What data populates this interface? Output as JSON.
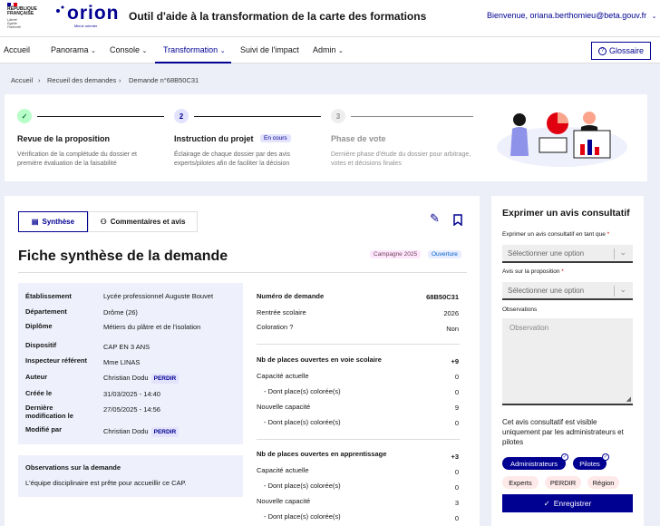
{
  "header": {
    "gov_label": [
      "RÉPUBLIQUE",
      "FRANÇAISE"
    ],
    "gov_motto": [
      "Liberté",
      "Égalité",
      "Fraternité"
    ],
    "logo_text": "orion",
    "logo_subtitle": "Mieux orienter",
    "app_title": "Outil d'aide à la transformation de la carte des formations",
    "welcome": "Bienvenue, oriana.berthomieu@beta.gouv.fr"
  },
  "nav": {
    "items": [
      "Accueil",
      "Panorama",
      "Console",
      "Transformation",
      "Suivi de l'impact",
      "Admin"
    ],
    "glossary": "Glossaire"
  },
  "breadcrumb": [
    "Accueil",
    "Recueil des demandes",
    "Demande n°68B50C31"
  ],
  "steps": [
    {
      "number": "✓",
      "title": "Revue de la proposition",
      "desc": "Vérification de la complétude du dossier et première évaluation de la faisabilité"
    },
    {
      "number": "2",
      "title": "Instruction du projet",
      "badge": "En cours",
      "desc": "Éclairage de chaque dossier par des avis experts/pilotes afin de faciliter la décision"
    },
    {
      "number": "3",
      "title": "Phase de vote",
      "desc": "Dernière phase d'étude du dossier pour arbitrage, votes et décisions finales"
    }
  ],
  "tabs": {
    "synthese": "Synthèse",
    "comments": "Commentaires et avis"
  },
  "fiche": {
    "title": "Fiche synthèse de la demande",
    "badge_campaign": "Campagne 2025",
    "badge_type": "Ouverture"
  },
  "details": [
    {
      "label": "Établissement",
      "value": "Lycée professionnel Auguste Bouvet"
    },
    {
      "label": "Département",
      "value": "Drôme (26)"
    },
    {
      "label": "Diplôme",
      "value": "Métiers du plâtre et de l'isolation"
    },
    {
      "label": "Dispositif",
      "value": "CAP EN 3 ANS"
    },
    {
      "label": "Inspecteur référent",
      "value": "Mme LINAS"
    },
    {
      "label": "Auteur",
      "value": "Christian Dodu",
      "tag": "PERDIR"
    },
    {
      "label": "Créée le",
      "value": "31/03/2025 - 14:40"
    },
    {
      "label": "Dernière modification le",
      "value": "27/05/2025 - 14:56"
    },
    {
      "label": "Modifié par",
      "value": "Christian Dodu",
      "tag": "PERDIR"
    }
  ],
  "observations": {
    "title": "Observations sur la demande",
    "text": "L'équipe disciplinaire est prête pour accueillir ce CAP."
  },
  "right_info": {
    "demande_label": "Numéro de demande",
    "demande_value": "68B50C31",
    "rentree_label": "Rentrée scolaire",
    "rentree_value": "2026",
    "coloration_label": "Coloration ?",
    "coloration_value": "Non",
    "scolaire_title": "Nb de places ouvertes en voie scolaire",
    "scolaire_value": "+9",
    "scolaire_rows": [
      {
        "label": "Capacité actuelle",
        "value": "0"
      },
      {
        "label": "- Dont place(s) colorée(s)",
        "value": "0"
      },
      {
        "label": "Nouvelle capacité",
        "value": "9"
      },
      {
        "label": "- Dont place(s) colorée(s)",
        "value": "0"
      }
    ],
    "appr_title": "Nb de places ouvertes en apprentissage",
    "appr_value": "+3",
    "appr_rows": [
      {
        "label": "Capacité actuelle",
        "value": "0"
      },
      {
        "label": "- Dont place(s) colorée(s)",
        "value": "0"
      },
      {
        "label": "Nouvelle capacité",
        "value": "3"
      },
      {
        "label": "- Dont place(s) colorée(s)",
        "value": "0"
      }
    ]
  },
  "avis": {
    "title": "Exprimer un avis consultatif",
    "role_label": "Exprimer un avis consultatif en tant que",
    "role_placeholder": "Sélectionner une option",
    "proposition_label": "Avis sur la proposition",
    "proposition_placeholder": "Sélectionner une option",
    "observations_label": "Observations",
    "observations_placeholder": "Observation",
    "visibility_text": "Cet avis consultatif est visible uniquement par les administrateurs et pilotes",
    "pills_selected": [
      "Administrateurs",
      "Pilotes"
    ],
    "pills_other": [
      "Experts",
      "PERDIR",
      "Région"
    ],
    "submit": "Enregistrer",
    "required_mark": "*"
  },
  "colors": {
    "primary": "#000091",
    "background": "#eceef8",
    "success": "#18753c",
    "required": "#ce0500"
  }
}
